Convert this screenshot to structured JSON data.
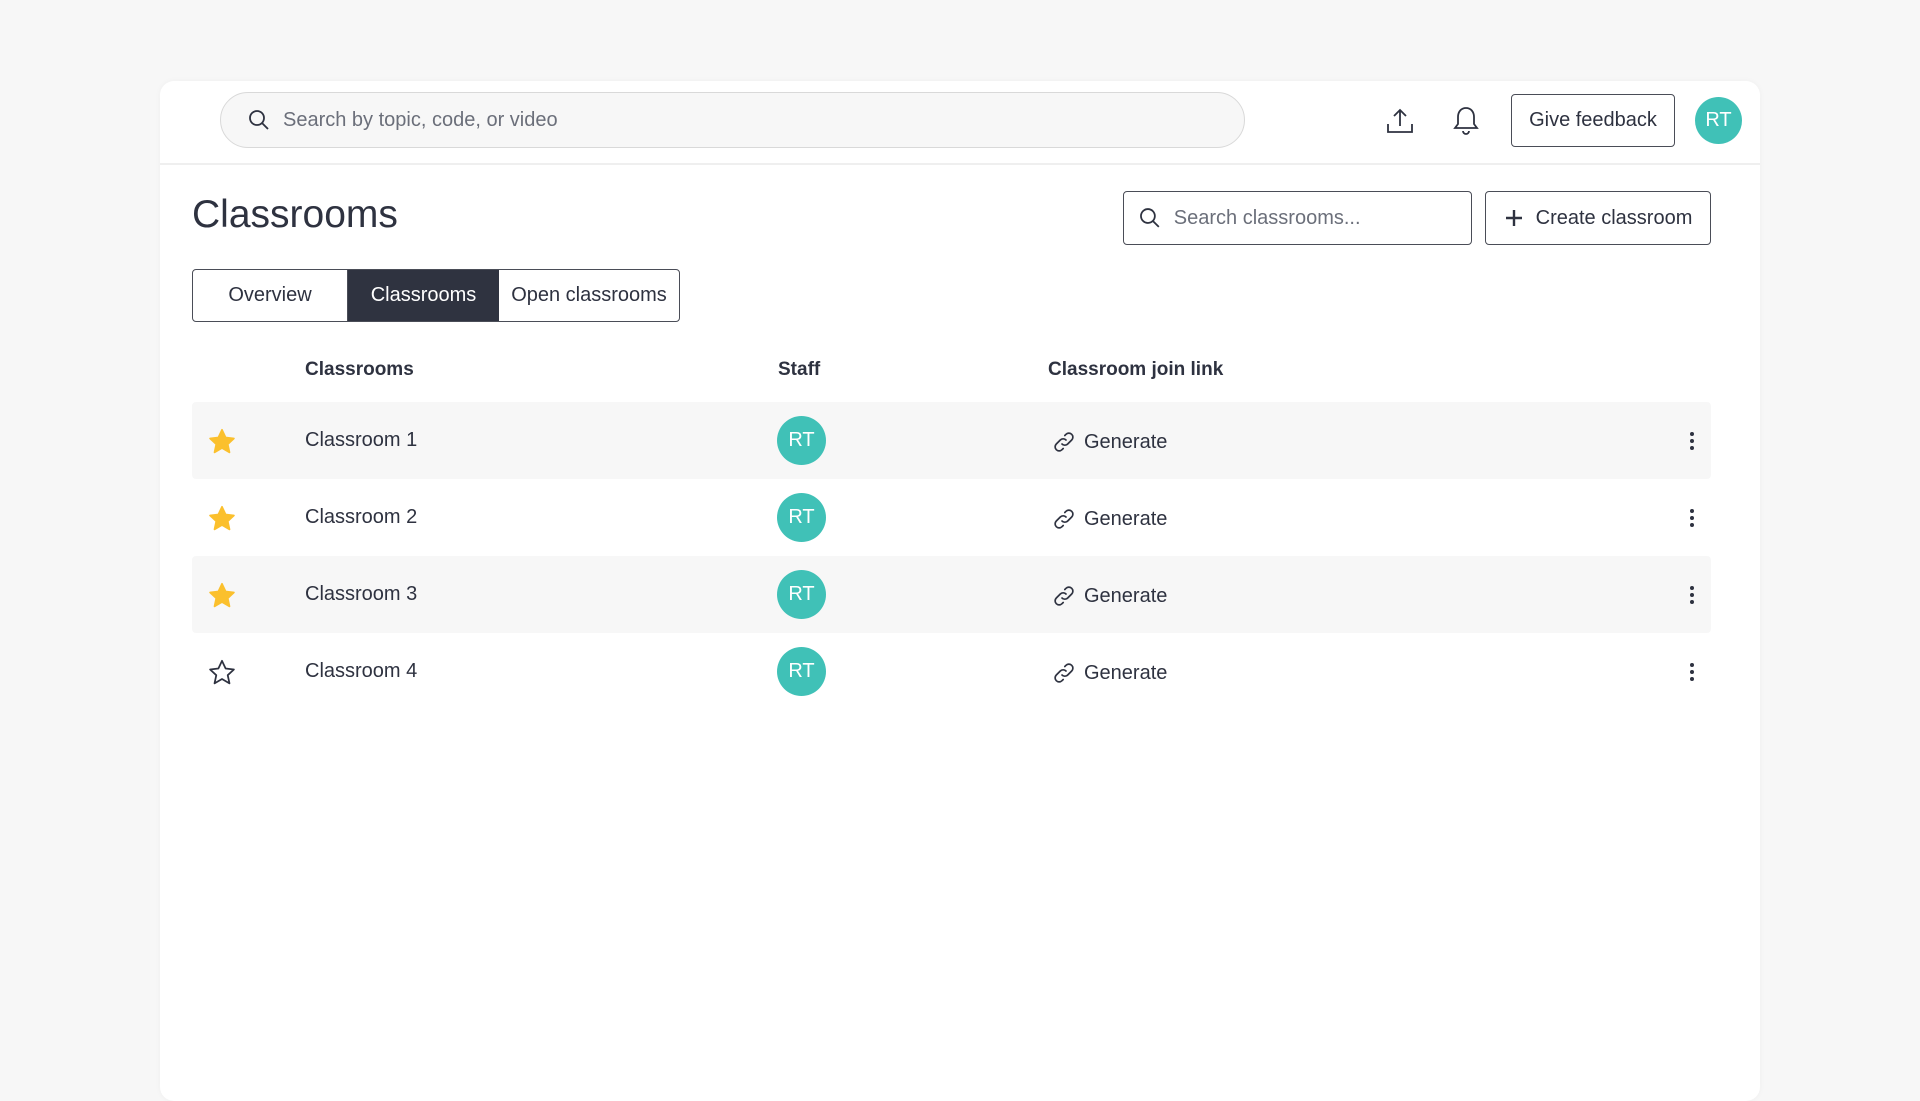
{
  "topbar": {
    "search_placeholder": "Search by topic, code, or video",
    "feedback_label": "Give feedback",
    "user_initials": "RT"
  },
  "page": {
    "title": "Classrooms",
    "search_placeholder": "Search classrooms...",
    "create_label": "Create classroom"
  },
  "tabs": [
    {
      "label": "Overview",
      "active": false
    },
    {
      "label": "Classrooms",
      "active": true
    },
    {
      "label": "Open classrooms",
      "active": false
    }
  ],
  "table": {
    "headers": [
      "Classrooms",
      "Staff",
      "Classroom join link"
    ],
    "rows": [
      {
        "name": "Classroom 1",
        "starred": true,
        "staff": "RT",
        "link": "Generate"
      },
      {
        "name": "Classroom 2",
        "starred": true,
        "staff": "RT",
        "link": "Generate"
      },
      {
        "name": "Classroom 3",
        "starred": true,
        "staff": "RT",
        "link": "Generate"
      },
      {
        "name": "Classroom 4",
        "starred": false,
        "staff": "RT",
        "link": "Generate"
      }
    ]
  },
  "colors": {
    "accent": "#40c1b7",
    "star": "#fbc02d",
    "dark": "#2f3340"
  }
}
